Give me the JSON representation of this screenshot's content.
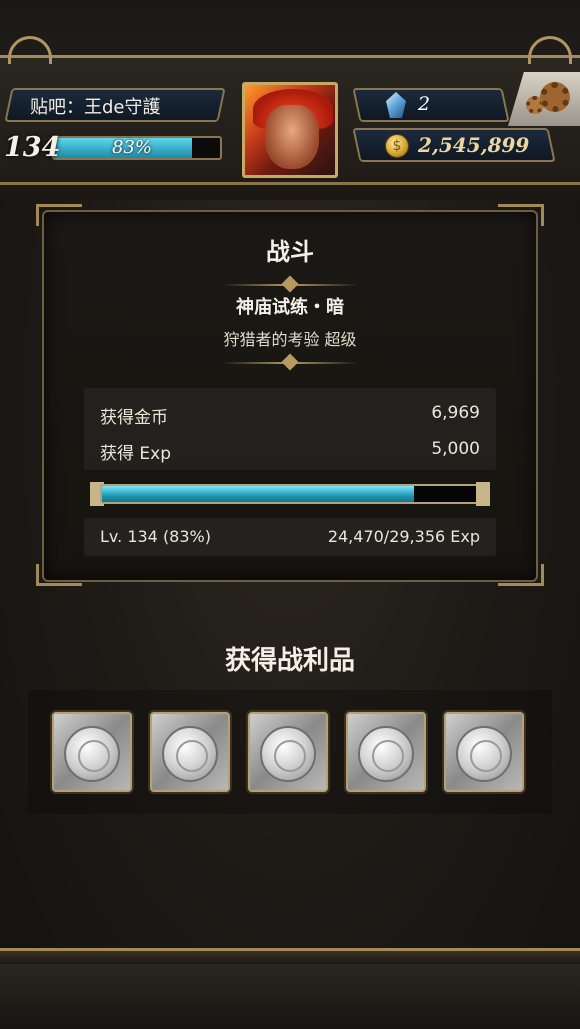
{
  "hud": {
    "player_name": "贴吧：王de守護",
    "level": "134",
    "xp_percent_text": "83%",
    "xp_fraction": 0.83,
    "gems": "2",
    "gold": "2,545,899"
  },
  "battle": {
    "title": "战斗",
    "stage_name": "神庙试练・暗",
    "stage_subtitle": "狩猎者的考验 超级",
    "rewards": [
      {
        "label": "获得金币",
        "value": "6,969"
      },
      {
        "label": "获得 Exp",
        "value": "5,000"
      }
    ],
    "exp_fraction": 0.83,
    "level_text": "Lv. 134 (83%)",
    "exp_text": "24,470/29,356 Exp"
  },
  "loot": {
    "title": "获得战利品",
    "items": [
      {
        "icon": "silver-coin-icon"
      },
      {
        "icon": "silver-coin-icon"
      },
      {
        "icon": "silver-coin-icon"
      },
      {
        "icon": "silver-coin-icon"
      },
      {
        "icon": "silver-coin-icon"
      }
    ]
  },
  "colors": {
    "accent_gold": "#a48a58",
    "exp_cyan": "#1f9ab6",
    "panel_bg": "#1b1915"
  }
}
